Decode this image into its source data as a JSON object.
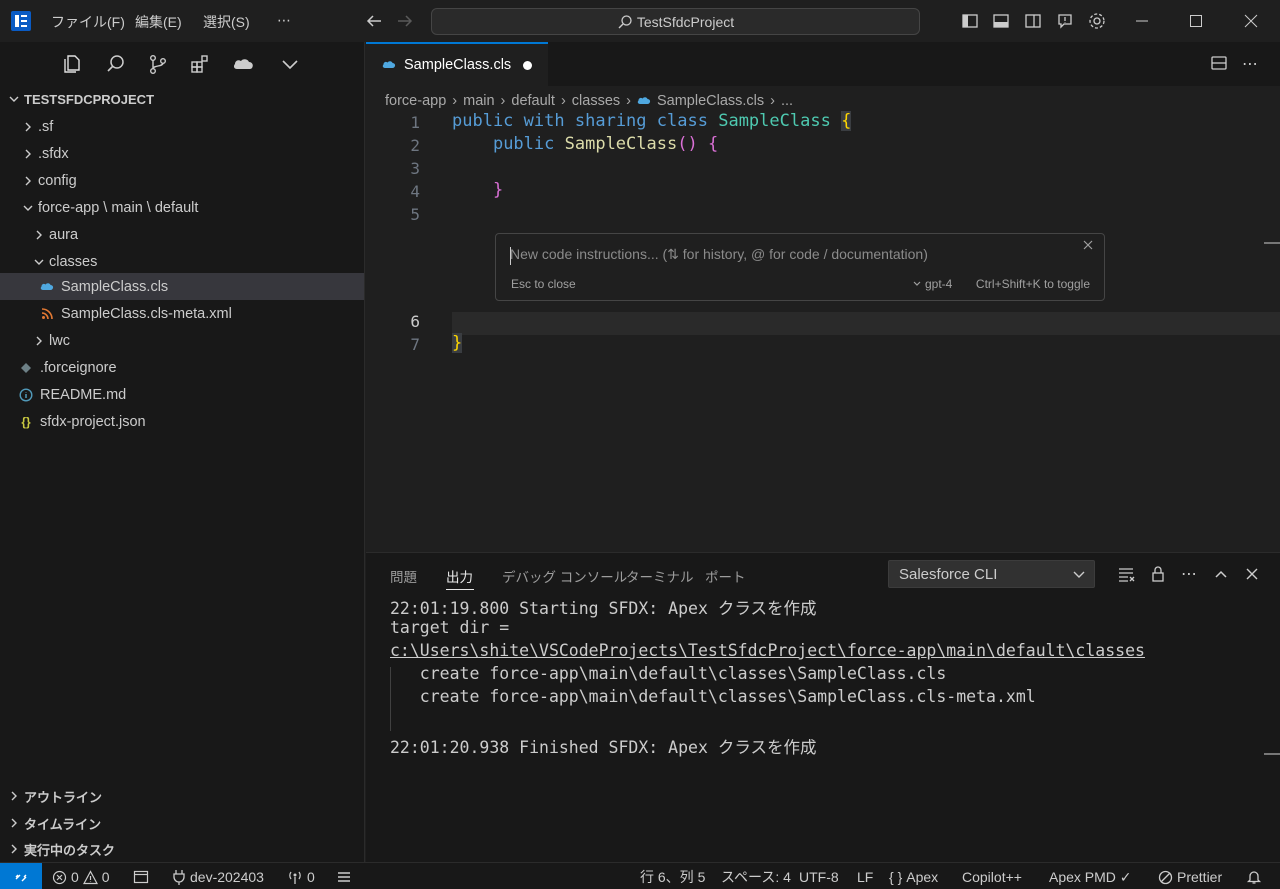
{
  "titlebar": {
    "menus": [
      "ファイル(F)",
      "編集(E)",
      "選択(S)",
      "⋯"
    ],
    "search_text": "TestSfdcProject"
  },
  "explorer": {
    "root": "TESTSFDCPROJECT",
    "items": [
      {
        "label": ".sf"
      },
      {
        "label": ".sfdx"
      },
      {
        "label": "config"
      },
      {
        "label": "force-app \\ main \\ default"
      },
      {
        "label": "aura"
      },
      {
        "label": "classes"
      },
      {
        "label": "SampleClass.cls"
      },
      {
        "label": "SampleClass.cls-meta.xml"
      },
      {
        "label": "lwc"
      },
      {
        "label": ".forceignore"
      },
      {
        "label": "README.md"
      },
      {
        "label": "sfdx-project.json"
      }
    ],
    "sections": [
      "アウトライン",
      "タイムライン",
      "実行中のタスク"
    ]
  },
  "editor": {
    "tab_label": "SampleClass.cls",
    "breadcrumb": [
      "force-app",
      "main",
      "default",
      "classes",
      "SampleClass.cls",
      "..."
    ],
    "line_numbers": [
      "1",
      "2",
      "3",
      "4",
      "5",
      "6",
      "7"
    ],
    "code": {
      "l1_public": "public",
      "l1_with": "with",
      "l1_sharing": "sharing",
      "l1_class": "class",
      "l1_name": "SampleClass",
      "l1_brace": "{",
      "l2_public": "public",
      "l2_name": "SampleClass",
      "l2_parens": "()",
      "l2_brace": "{",
      "l4_brace": "}",
      "l7_brace": "}"
    },
    "inline_chat": {
      "placeholder": "New code instructions... (⇅ for history, @ for code / documentation)",
      "esc_hint": "Esc to close",
      "model": "gpt-4",
      "toggle_hint": "Ctrl+Shift+K to toggle"
    }
  },
  "panel": {
    "tabs": [
      "問題",
      "出力",
      "デバッグ コンソール",
      "ターミナル",
      "ポート"
    ],
    "channel": "Salesforce CLI",
    "output": [
      "22:01:19.800 Starting SFDX: Apex クラスを作成",
      "target dir =",
      "c:\\Users\\shite\\VSCodeProjects\\TestSfdcProject\\force-app\\main\\default\\classes",
      "   create force-app\\main\\default\\classes\\SampleClass.cls",
      "   create force-app\\main\\default\\classes\\SampleClass.cls-meta.xml",
      "22:01:20.938 Finished SFDX: Apex クラスを作成"
    ]
  },
  "statusbar": {
    "errors": "0",
    "warnings": "0",
    "org": "dev-202403",
    "ports": "0",
    "position": "行 6、列 5",
    "spaces": "スペース: 4",
    "encoding": "UTF-8",
    "eol": "LF",
    "language": "Apex",
    "copilot": "Copilot++",
    "pmd": "Apex PMD ✓",
    "prettier": "Prettier"
  },
  "colors": {
    "accent": "#0078d4",
    "salesforce_blue": "#4fa8e0"
  }
}
